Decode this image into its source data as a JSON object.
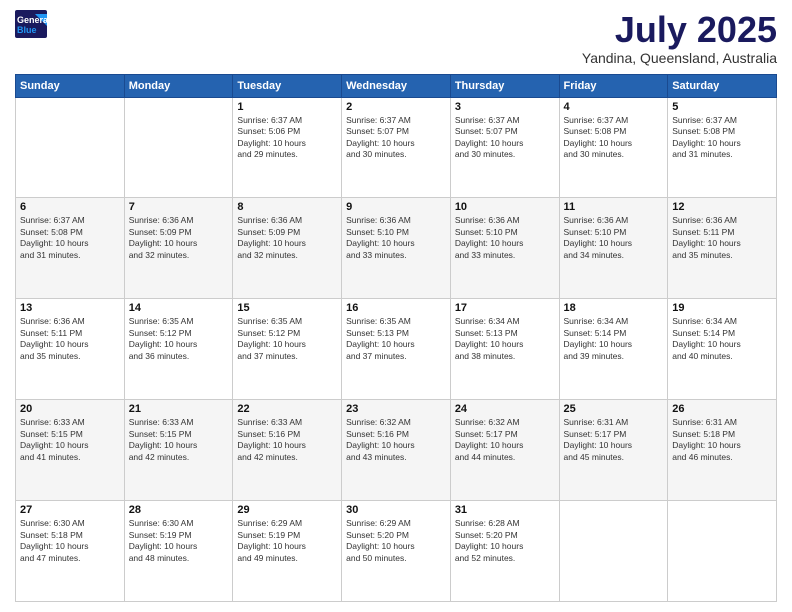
{
  "header": {
    "logo_line1": "General",
    "logo_line2": "Blue",
    "month": "July 2025",
    "location": "Yandina, Queensland, Australia"
  },
  "days_of_week": [
    "Sunday",
    "Monday",
    "Tuesday",
    "Wednesday",
    "Thursday",
    "Friday",
    "Saturday"
  ],
  "weeks": [
    [
      {
        "day": "",
        "content": ""
      },
      {
        "day": "",
        "content": ""
      },
      {
        "day": "1",
        "content": "Sunrise: 6:37 AM\nSunset: 5:06 PM\nDaylight: 10 hours\nand 29 minutes."
      },
      {
        "day": "2",
        "content": "Sunrise: 6:37 AM\nSunset: 5:07 PM\nDaylight: 10 hours\nand 30 minutes."
      },
      {
        "day": "3",
        "content": "Sunrise: 6:37 AM\nSunset: 5:07 PM\nDaylight: 10 hours\nand 30 minutes."
      },
      {
        "day": "4",
        "content": "Sunrise: 6:37 AM\nSunset: 5:08 PM\nDaylight: 10 hours\nand 30 minutes."
      },
      {
        "day": "5",
        "content": "Sunrise: 6:37 AM\nSunset: 5:08 PM\nDaylight: 10 hours\nand 31 minutes."
      }
    ],
    [
      {
        "day": "6",
        "content": "Sunrise: 6:37 AM\nSunset: 5:08 PM\nDaylight: 10 hours\nand 31 minutes."
      },
      {
        "day": "7",
        "content": "Sunrise: 6:36 AM\nSunset: 5:09 PM\nDaylight: 10 hours\nand 32 minutes."
      },
      {
        "day": "8",
        "content": "Sunrise: 6:36 AM\nSunset: 5:09 PM\nDaylight: 10 hours\nand 32 minutes."
      },
      {
        "day": "9",
        "content": "Sunrise: 6:36 AM\nSunset: 5:10 PM\nDaylight: 10 hours\nand 33 minutes."
      },
      {
        "day": "10",
        "content": "Sunrise: 6:36 AM\nSunset: 5:10 PM\nDaylight: 10 hours\nand 33 minutes."
      },
      {
        "day": "11",
        "content": "Sunrise: 6:36 AM\nSunset: 5:10 PM\nDaylight: 10 hours\nand 34 minutes."
      },
      {
        "day": "12",
        "content": "Sunrise: 6:36 AM\nSunset: 5:11 PM\nDaylight: 10 hours\nand 35 minutes."
      }
    ],
    [
      {
        "day": "13",
        "content": "Sunrise: 6:36 AM\nSunset: 5:11 PM\nDaylight: 10 hours\nand 35 minutes."
      },
      {
        "day": "14",
        "content": "Sunrise: 6:35 AM\nSunset: 5:12 PM\nDaylight: 10 hours\nand 36 minutes."
      },
      {
        "day": "15",
        "content": "Sunrise: 6:35 AM\nSunset: 5:12 PM\nDaylight: 10 hours\nand 37 minutes."
      },
      {
        "day": "16",
        "content": "Sunrise: 6:35 AM\nSunset: 5:13 PM\nDaylight: 10 hours\nand 37 minutes."
      },
      {
        "day": "17",
        "content": "Sunrise: 6:34 AM\nSunset: 5:13 PM\nDaylight: 10 hours\nand 38 minutes."
      },
      {
        "day": "18",
        "content": "Sunrise: 6:34 AM\nSunset: 5:14 PM\nDaylight: 10 hours\nand 39 minutes."
      },
      {
        "day": "19",
        "content": "Sunrise: 6:34 AM\nSunset: 5:14 PM\nDaylight: 10 hours\nand 40 minutes."
      }
    ],
    [
      {
        "day": "20",
        "content": "Sunrise: 6:33 AM\nSunset: 5:15 PM\nDaylight: 10 hours\nand 41 minutes."
      },
      {
        "day": "21",
        "content": "Sunrise: 6:33 AM\nSunset: 5:15 PM\nDaylight: 10 hours\nand 42 minutes."
      },
      {
        "day": "22",
        "content": "Sunrise: 6:33 AM\nSunset: 5:16 PM\nDaylight: 10 hours\nand 42 minutes."
      },
      {
        "day": "23",
        "content": "Sunrise: 6:32 AM\nSunset: 5:16 PM\nDaylight: 10 hours\nand 43 minutes."
      },
      {
        "day": "24",
        "content": "Sunrise: 6:32 AM\nSunset: 5:17 PM\nDaylight: 10 hours\nand 44 minutes."
      },
      {
        "day": "25",
        "content": "Sunrise: 6:31 AM\nSunset: 5:17 PM\nDaylight: 10 hours\nand 45 minutes."
      },
      {
        "day": "26",
        "content": "Sunrise: 6:31 AM\nSunset: 5:18 PM\nDaylight: 10 hours\nand 46 minutes."
      }
    ],
    [
      {
        "day": "27",
        "content": "Sunrise: 6:30 AM\nSunset: 5:18 PM\nDaylight: 10 hours\nand 47 minutes."
      },
      {
        "day": "28",
        "content": "Sunrise: 6:30 AM\nSunset: 5:19 PM\nDaylight: 10 hours\nand 48 minutes."
      },
      {
        "day": "29",
        "content": "Sunrise: 6:29 AM\nSunset: 5:19 PM\nDaylight: 10 hours\nand 49 minutes."
      },
      {
        "day": "30",
        "content": "Sunrise: 6:29 AM\nSunset: 5:20 PM\nDaylight: 10 hours\nand 50 minutes."
      },
      {
        "day": "31",
        "content": "Sunrise: 6:28 AM\nSunset: 5:20 PM\nDaylight: 10 hours\nand 52 minutes."
      },
      {
        "day": "",
        "content": ""
      },
      {
        "day": "",
        "content": ""
      }
    ]
  ]
}
